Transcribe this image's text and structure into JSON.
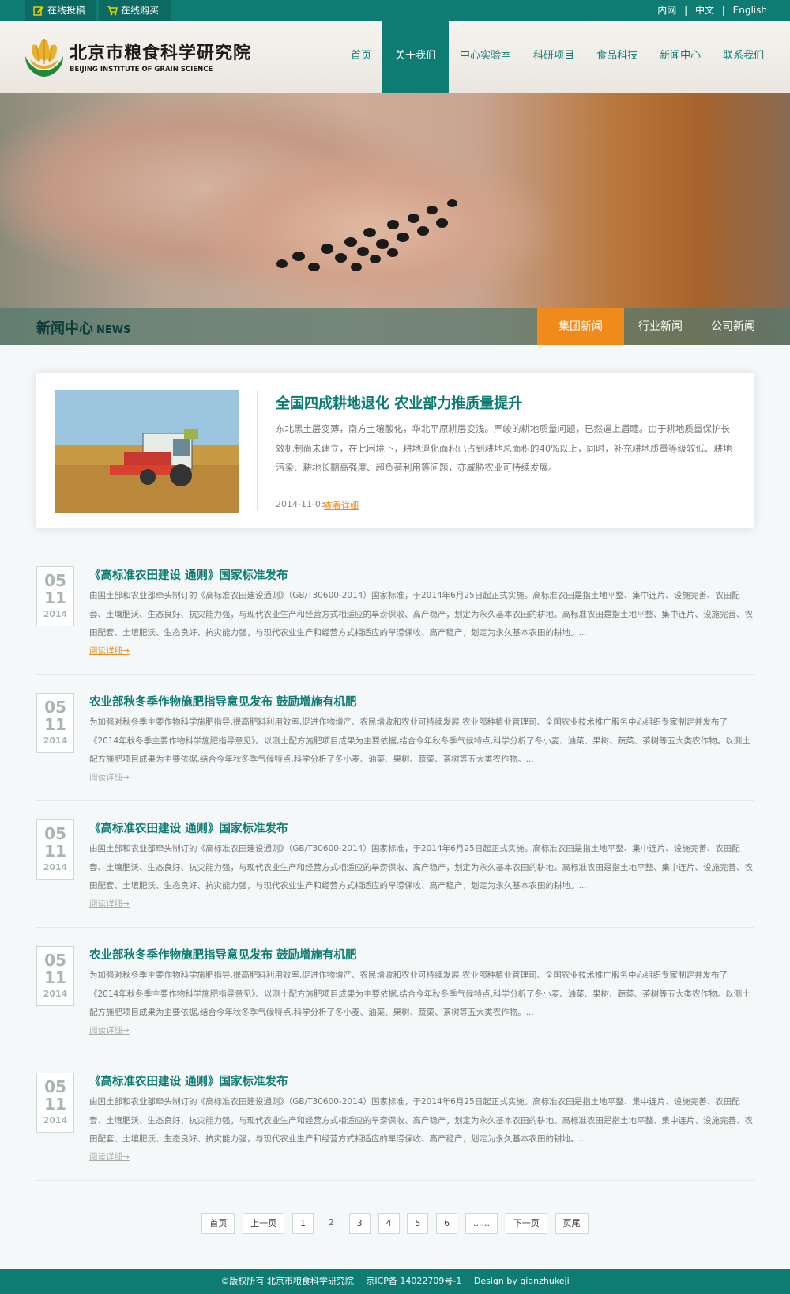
{
  "topbar": {
    "submit_label": "在线投稿",
    "buy_label": "在线购买",
    "intranet": "内网",
    "sep1": "|",
    "chinese": "中文",
    "sep2": "|",
    "english": "English"
  },
  "header": {
    "logo_cn": "北京市粮食科学研究院",
    "logo_en": "BEIJING INSTITUTE OF GRAIN SCIENCE",
    "nav": [
      "首页",
      "关于我们",
      "中心实验室",
      "科研项目",
      "食品科技",
      "新闻中心",
      "联系我们"
    ],
    "active_nav": "关于我们"
  },
  "section": {
    "title": "新闻中心",
    "title_en": "NEWS",
    "tabs": [
      "集团新闻",
      "行业新闻",
      "公司新闻"
    ],
    "active_tab": "集团新闻"
  },
  "featured": {
    "title": "全国四成耕地退化 农业部力推质量提升",
    "desc": "东北黑土层变薄，南方土壤酸化，华北平原耕层变浅。严峻的耕地质量问题，已然逼上眉睫。由于耕地质量保护长效机制尚未建立，在此困境下，耕地退化面积已占到耕地总面积的40%以上，同时，补充耕地质量等级较低、耕地污染、耕地长期高强度、超负荷利用等问题，亦威胁农业可持续发展。",
    "date": "2014-11-05",
    "more": "查看详细"
  },
  "news": [
    {
      "day": "05",
      "month": "11",
      "year": "2014",
      "title": "《高标准农田建设 通则》国家标准发布",
      "desc": "由国土部和农业部牵头制订的《高标准农田建设通则》（GB/T30600-2014）国家标准，于2014年6月25日起正式实施。高标准农田是指土地平整、集中连片、设施完善、农田配套、土壤肥沃、生态良好、抗灾能力强，与现代农业生产和经营方式相适应的旱涝保收、高产稳产，划定为永久基本农田的耕地。高标准农田是指土地平整、集中连片、设施完善、农田配套、土壤肥沃、生态良好、抗灾能力强，与现代农业生产和经营方式相适应的旱涝保收、高产稳产，划定为永久基本农田的耕地。...",
      "more": "阅读详细→"
    },
    {
      "day": "05",
      "month": "11",
      "year": "2014",
      "title": "农业部秋冬季作物施肥指导意见发布 鼓励增施有机肥",
      "desc": "为加强对秋冬季主要作物科学施肥指导,提高肥料利用效率,促进作物增产、农民增收和农业可持续发展,农业部种植业管理司、全国农业技术推广服务中心组织专家制定并发布了《2014年秋冬季主要作物科学施肥指导意见》。以测土配方施肥项目成果为主要依据,结合今年秋冬季气候特点,科学分析了冬小麦、油菜、果树、蔬菜、茶树等五大类农作物。以测土配方施肥项目成果为主要依据,结合今年秋冬季气候特点,科学分析了冬小麦、油菜、果树、蔬菜、茶树等五大类农作物。...",
      "more": "阅读详细→"
    },
    {
      "day": "05",
      "month": "11",
      "year": "2014",
      "title": "《高标准农田建设 通则》国家标准发布",
      "desc": "由国土部和农业部牵头制订的《高标准农田建设通则》（GB/T30600-2014）国家标准，于2014年6月25日起正式实施。高标准农田是指土地平整、集中连片、设施完善、农田配套、土壤肥沃、生态良好、抗灾能力强，与现代农业生产和经营方式相适应的旱涝保收、高产稳产，划定为永久基本农田的耕地。高标准农田是指土地平整、集中连片、设施完善、农田配套、土壤肥沃、生态良好、抗灾能力强，与现代农业生产和经营方式相适应的旱涝保收、高产稳产，划定为永久基本农田的耕地。...",
      "more": "阅读详细→"
    },
    {
      "day": "05",
      "month": "11",
      "year": "2014",
      "title": "农业部秋冬季作物施肥指导意见发布 鼓励增施有机肥",
      "desc": "为加强对秋冬季主要作物科学施肥指导,提高肥料利用效率,促进作物增产、农民增收和农业可持续发展,农业部种植业管理司、全国农业技术推广服务中心组织专家制定并发布了《2014年秋冬季主要作物科学施肥指导意见》。以测土配方施肥项目成果为主要依据,结合今年秋冬季气候特点,科学分析了冬小麦、油菜、果树、蔬菜、茶树等五大类农作物。以测土配方施肥项目成果为主要依据,结合今年秋冬季气候特点,科学分析了冬小麦、油菜、果树、蔬菜、茶树等五大类农作物。...",
      "more": "阅读详细→"
    },
    {
      "day": "05",
      "month": "11",
      "year": "2014",
      "title": "《高标准农田建设 通则》国家标准发布",
      "desc": "由国土部和农业部牵头制订的《高标准农田建设通则》（GB/T30600-2014）国家标准，于2014年6月25日起正式实施。高标准农田是指土地平整、集中连片、设施完善、农田配套、土壤肥沃、生态良好、抗灾能力强，与现代农业生产和经营方式相适应的旱涝保收、高产稳产，划定为永久基本农田的耕地。高标准农田是指土地平整、集中连片、设施完善、农田配套、土壤肥沃、生态良好、抗灾能力强，与现代农业生产和经营方式相适应的旱涝保收、高产稳产，划定为永久基本农田的耕地。...",
      "more": "阅读详细→"
    }
  ],
  "pagination": [
    "首页",
    "上一页",
    "1",
    "2",
    "3",
    "4",
    "5",
    "6",
    "......",
    "下一页",
    "页尾"
  ],
  "current_page": "2",
  "footer": {
    "copyright": "©版权所有  北京市粮食科学研究院",
    "icp": "京ICP备 14022709号-1",
    "design": "Design by qianzhukeji"
  },
  "colors": {
    "brand": "#0e7c72",
    "accent": "#f08a1b"
  },
  "icons": {
    "submit": "edit-icon",
    "buy": "cart-icon"
  }
}
